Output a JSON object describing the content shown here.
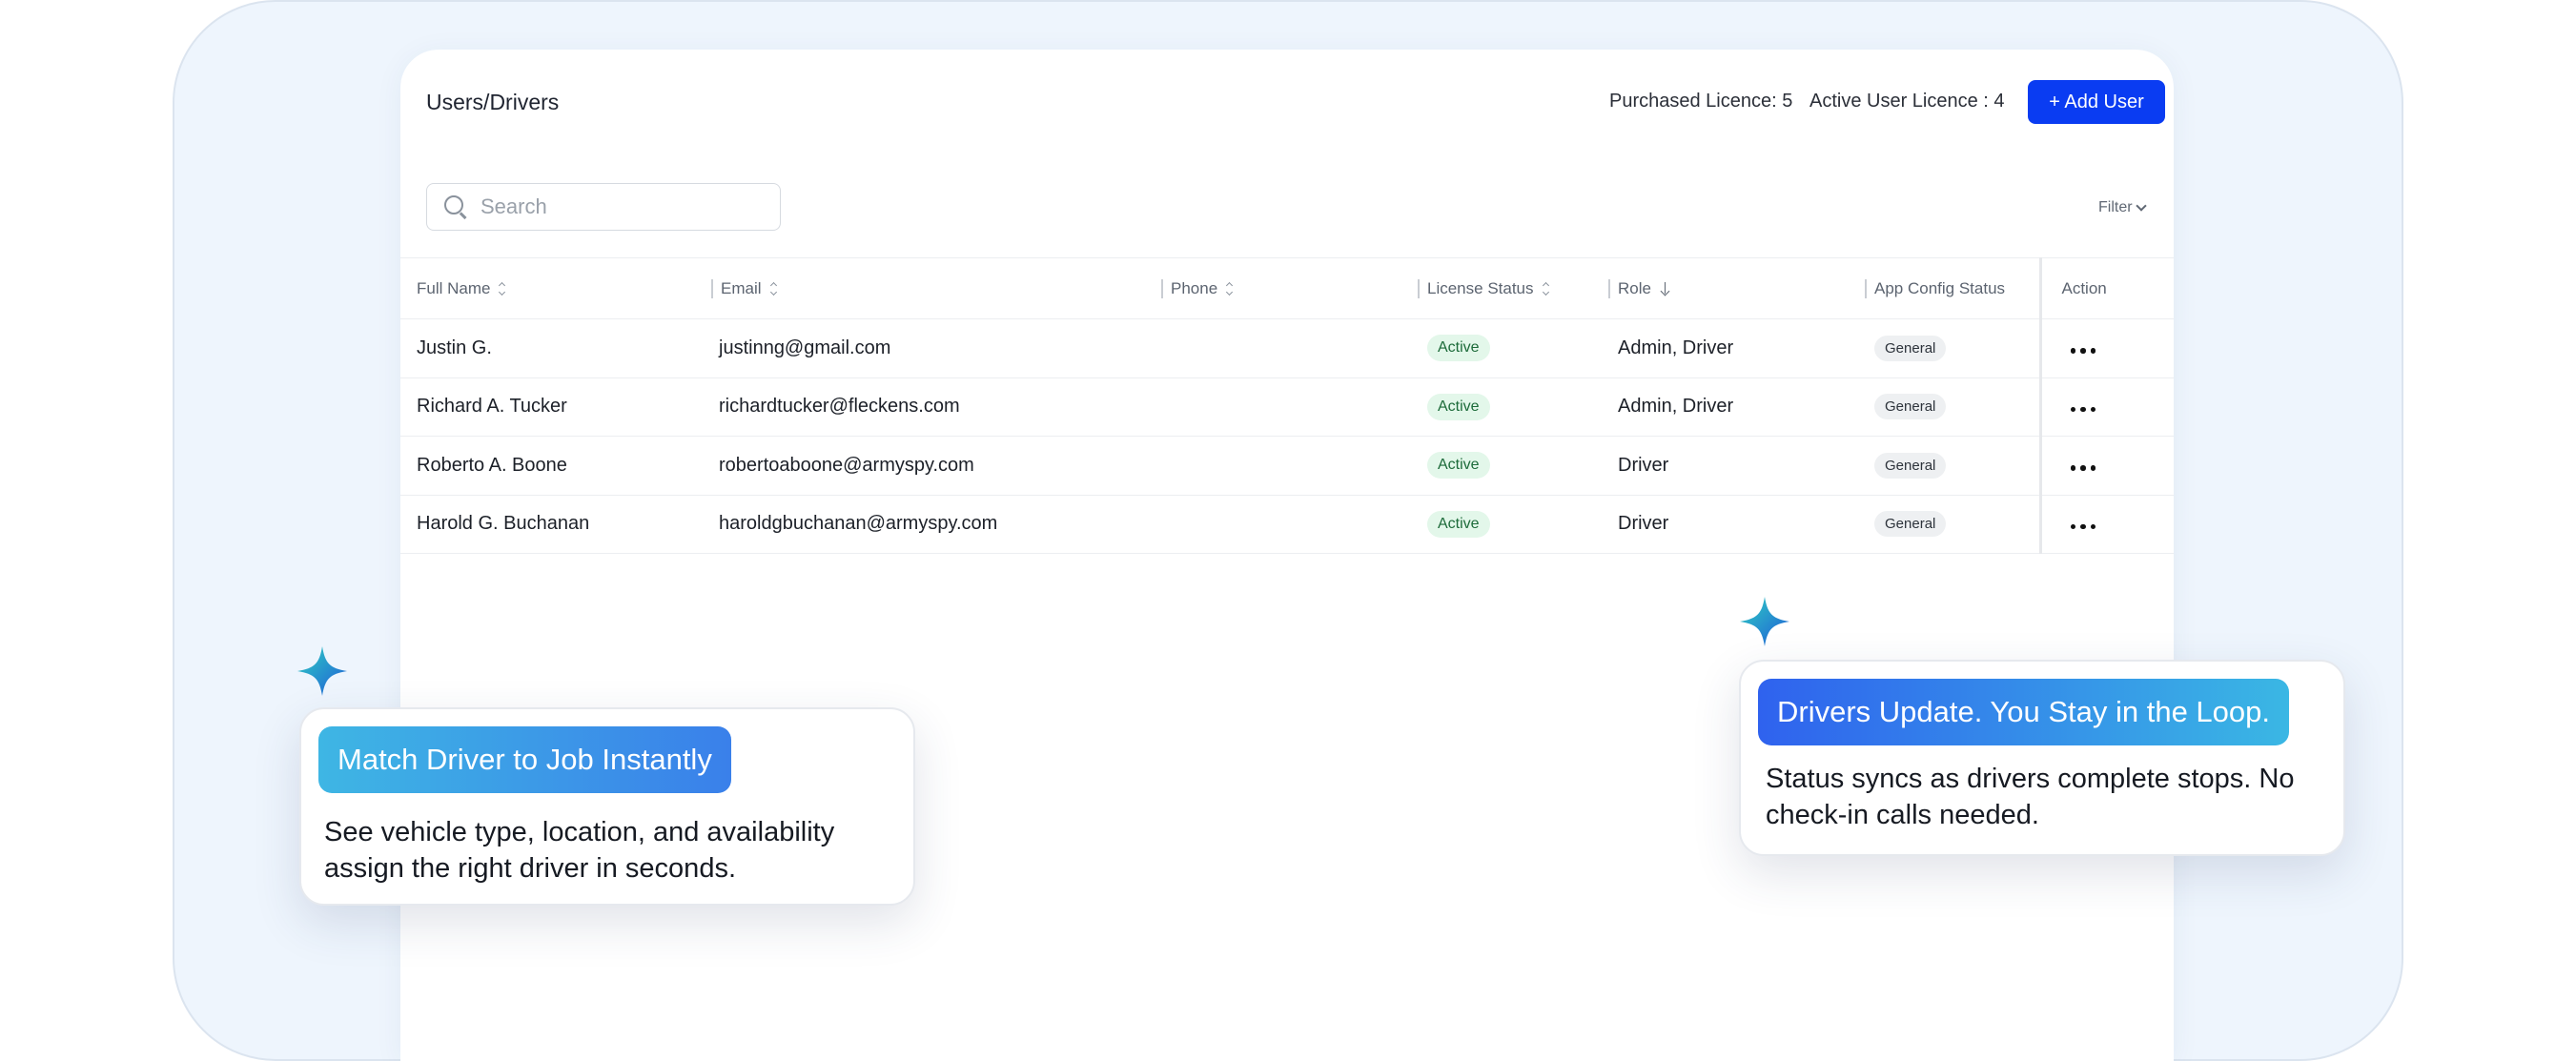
{
  "header": {
    "title": "Users/Drivers",
    "purchased_licence": "Purchased Licence: 5",
    "active_user_licence": "Active User Licence : 4",
    "add_user_label": "+ Add User"
  },
  "search": {
    "placeholder": "Search",
    "value": ""
  },
  "filter": {
    "label": "Filter"
  },
  "table": {
    "columns": {
      "full_name": "Full Name",
      "email": "Email",
      "phone": "Phone",
      "license_status": "License Status",
      "role": "Role",
      "app_config_status": "App Config Status",
      "action": "Action"
    },
    "rows": [
      {
        "name": "Justin G.",
        "email": "justinng@gmail.com",
        "phone": "",
        "license_status": "Active",
        "role": "Admin, Driver",
        "app_config": "General"
      },
      {
        "name": "Richard A. Tucker",
        "email": "richardtucker@fleckens.com",
        "phone": "",
        "license_status": "Active",
        "role": "Admin, Driver",
        "app_config": "General"
      },
      {
        "name": "Roberto A. Boone",
        "email": "robertoaboone@armyspy.com",
        "phone": "",
        "license_status": "Active",
        "role": "Driver",
        "app_config": "General"
      },
      {
        "name": "Harold G. Buchanan",
        "email": "haroldgbuchanan@armyspy.com",
        "phone": "",
        "license_status": "Active",
        "role": "Driver",
        "app_config": "General"
      }
    ]
  },
  "callouts": {
    "left": {
      "title": "Match Driver to Job Instantly",
      "body": "See vehicle type, location, and availability assign the right driver in seconds."
    },
    "right": {
      "title": "Drivers Update. You Stay in the Loop.",
      "body": "Status syncs as drivers complete stops. No check-in calls needed."
    }
  },
  "colors": {
    "primary_button": "#0a3cf2",
    "active_badge_bg": "#e3f7ea",
    "active_badge_text": "#1d6b3a",
    "frame_bg": "#eef5fd"
  },
  "icons": {
    "search": "search-icon",
    "filter": "chevron-down-icon",
    "action": "more-horizontal-icon",
    "sparkle": "sparkle-icon"
  }
}
